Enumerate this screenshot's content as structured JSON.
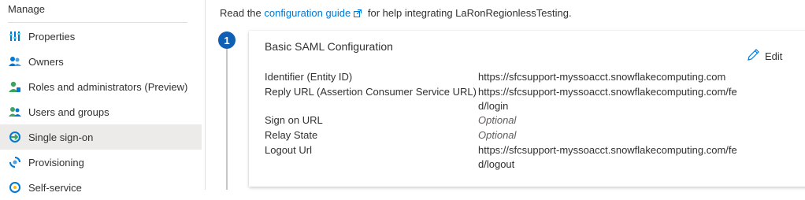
{
  "sidebar": {
    "section_title": "Manage",
    "items": [
      {
        "label": "Properties",
        "icon": "properties-icon"
      },
      {
        "label": "Owners",
        "icon": "owners-icon"
      },
      {
        "label": "Roles and administrators (Preview)",
        "icon": "roles-icon"
      },
      {
        "label": "Users and groups",
        "icon": "users-groups-icon"
      },
      {
        "label": "Single sign-on",
        "icon": "single-sign-on-icon",
        "selected": true
      },
      {
        "label": "Provisioning",
        "icon": "provisioning-icon"
      },
      {
        "label": "Self-service",
        "icon": "self-service-icon"
      }
    ]
  },
  "intro": {
    "prefix": "Read the",
    "link": "configuration guide",
    "suffix": "for help integrating LaRonRegionlessTesting."
  },
  "step": {
    "number": "1"
  },
  "card": {
    "title": "Basic SAML Configuration",
    "edit_label": "Edit",
    "rows": [
      {
        "label": "Identifier (Entity ID)",
        "value": "https://sfcsupport-myssoacct.snowflakecomputing.com",
        "optional": false
      },
      {
        "label": "Reply URL (Assertion Consumer Service URL)",
        "value": "https://sfcsupport-myssoacct.snowflakecomputing.com/fed/login",
        "optional": false
      },
      {
        "label": "Sign on URL",
        "value": "Optional",
        "optional": true
      },
      {
        "label": "Relay State",
        "value": "Optional",
        "optional": true
      },
      {
        "label": "Logout Url",
        "value": "https://sfcsupport-myssoacct.snowflakecomputing.com/fed/logout",
        "optional": false
      }
    ]
  },
  "colors": {
    "accent": "#0078d4",
    "badge": "#0f5fb4",
    "selected_bg": "#edebe9"
  }
}
